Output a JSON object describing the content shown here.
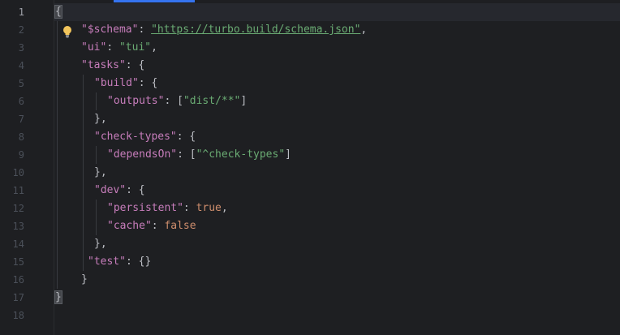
{
  "gutter": {
    "line_numbers": [
      "1",
      "2",
      "3",
      "4",
      "5",
      "6",
      "7",
      "8",
      "9",
      "10",
      "11",
      "12",
      "13",
      "14",
      "15",
      "16",
      "17",
      "18"
    ]
  },
  "icons": {
    "intention": "lightbulb-icon"
  },
  "colors": {
    "background": "#1e1f22",
    "key": "#c77dbb",
    "string": "#6aab73",
    "keyword": "#cf8e6d",
    "punctuation": "#bcbec4",
    "line_number": "#4b5059",
    "accent": "#3574f0",
    "bulb": "#f2c55c"
  },
  "code": {
    "open_brace": "{",
    "close_brace": "}",
    "schema_key": "\"$schema\"",
    "schema_value": "\"https://turbo.build/schema.json\"",
    "ui_key": "\"ui\"",
    "ui_value": "\"tui\"",
    "tasks_key": "\"tasks\"",
    "build_key": "\"build\"",
    "outputs_key": "\"outputs\"",
    "outputs_value": "\"dist/**\"",
    "check_types_key": "\"check-types\"",
    "depends_on_key": "\"dependsOn\"",
    "depends_on_value": "\"^check-types\"",
    "dev_key": "\"dev\"",
    "persistent_key": "\"persistent\"",
    "persistent_value": "true",
    "cache_key": "\"cache\"",
    "cache_value": "false",
    "test_key": "\"test\"",
    "empty_object": "{}"
  }
}
